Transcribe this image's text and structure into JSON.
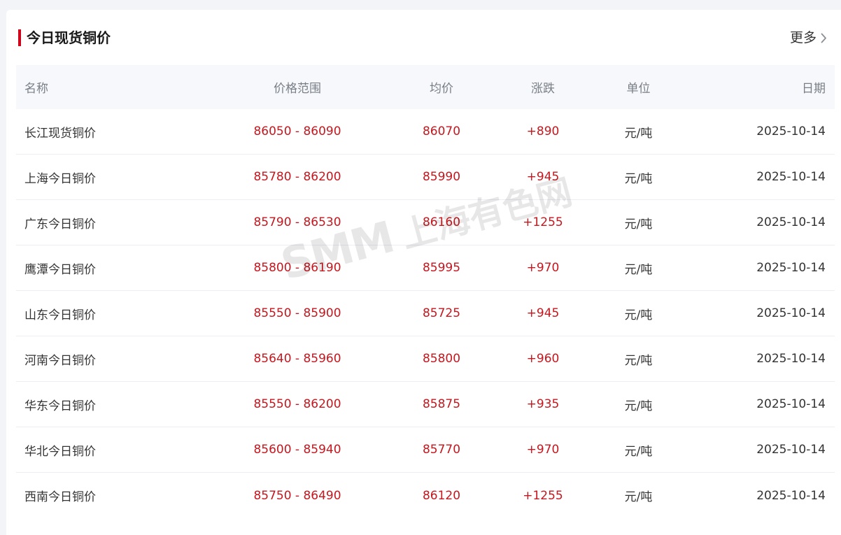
{
  "header": {
    "title": "今日现货铜价",
    "more_label": "更多"
  },
  "table": {
    "columns": {
      "name": "名称",
      "range": "价格范围",
      "avg": "均价",
      "change": "涨跌",
      "unit": "单位",
      "date": "日期"
    },
    "rows": [
      {
        "name": "长江现货铜价",
        "range": "86050 - 86090",
        "avg": "86070",
        "change": "+890",
        "unit": "元/吨",
        "date": "2025-10-14"
      },
      {
        "name": "上海今日铜价",
        "range": "85780 - 86200",
        "avg": "85990",
        "change": "+945",
        "unit": "元/吨",
        "date": "2025-10-14"
      },
      {
        "name": "广东今日铜价",
        "range": "85790 - 86530",
        "avg": "86160",
        "change": "+1255",
        "unit": "元/吨",
        "date": "2025-10-14"
      },
      {
        "name": "鹰潭今日铜价",
        "range": "85800 - 86190",
        "avg": "85995",
        "change": "+970",
        "unit": "元/吨",
        "date": "2025-10-14"
      },
      {
        "name": "山东今日铜价",
        "range": "85550 - 85900",
        "avg": "85725",
        "change": "+945",
        "unit": "元/吨",
        "date": "2025-10-14"
      },
      {
        "name": "河南今日铜价",
        "range": "85640 - 85960",
        "avg": "85800",
        "change": "+960",
        "unit": "元/吨",
        "date": "2025-10-14"
      },
      {
        "name": "华东今日铜价",
        "range": "85550 - 86200",
        "avg": "85875",
        "change": "+935",
        "unit": "元/吨",
        "date": "2025-10-14"
      },
      {
        "name": "华北今日铜价",
        "range": "85600 - 85940",
        "avg": "85770",
        "change": "+970",
        "unit": "元/吨",
        "date": "2025-10-14"
      },
      {
        "name": "西南今日铜价",
        "range": "85750 - 86490",
        "avg": "86120",
        "change": "+1255",
        "unit": "元/吨",
        "date": "2025-10-14"
      }
    ]
  },
  "watermark": {
    "logo": "SMM",
    "text": "上海有色网"
  },
  "colors": {
    "accent": "#d0021b",
    "price_red": "#c4171e",
    "header_bg": "#f6f8fb"
  },
  "icons": {
    "more": "chevron-right-icon"
  }
}
